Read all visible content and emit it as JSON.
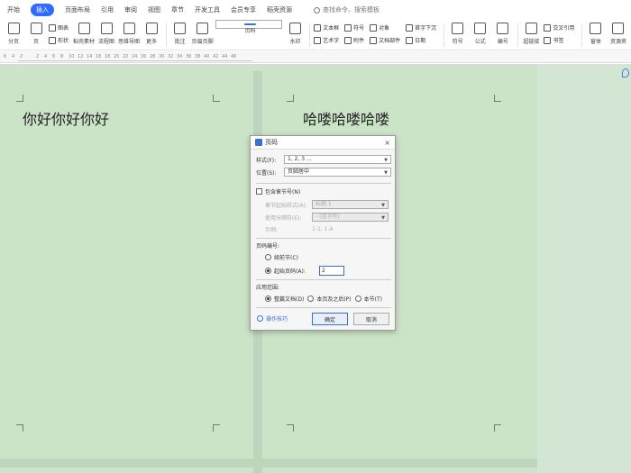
{
  "menu": {
    "items": [
      "开始",
      "插入",
      "页面布局",
      "引用",
      "审阅",
      "视图",
      "章节",
      "开发工具",
      "会员专享",
      "稻壳资源"
    ],
    "active_index": 1,
    "search_text": "查找命令、搜索模板"
  },
  "ribbon": {
    "items_left": [
      "分页",
      "页",
      "图表",
      "形状",
      "稻壳素材",
      "流程图",
      "思维导图",
      "更多",
      "批注",
      "页眉页脚",
      "页码",
      "水印"
    ],
    "groups_mid": [
      {
        "row1": "文本框",
        "row2": "艺术字"
      },
      {
        "row1": "符号",
        "row2": "附件"
      },
      {
        "row1": "对象",
        "row2": "文档部件"
      },
      {
        "row1": "首字下沉",
        "row2": "日期"
      }
    ],
    "items_right": [
      "符号",
      "公式",
      "编号",
      "超链接",
      "交叉引用",
      "书签",
      "窗体",
      "资源夹"
    ],
    "selected_index": 10
  },
  "ruler": {
    "ticks": [
      "6",
      "4",
      "2",
      "",
      "2",
      "4",
      "6",
      "8",
      "10",
      "12",
      "14",
      "16",
      "18",
      "20",
      "22",
      "24",
      "26",
      "28",
      "30",
      "32",
      "34",
      "36",
      "38",
      "40",
      "42",
      "44",
      "46"
    ]
  },
  "document": {
    "page1_text": "你好你好你好",
    "page2_text": "哈喽哈喽哈喽"
  },
  "dialog": {
    "title": "页码",
    "style_label": "样式(F):",
    "style_value": "1, 2, 3 ...",
    "position_label": "位置(S):",
    "position_value": "页脚居中",
    "include_chapter_label": "包含章节号(N)",
    "include_chapter_checked": false,
    "chapter_style_label": "章节起始样式(A):",
    "chapter_style_value": "标题 1",
    "separator_label": "使用分隔符(E):",
    "separator_value": "- (连字符)",
    "example_label": "示例:",
    "example_value": "1-1, 1-A",
    "numbering_label": "页码编号:",
    "continue_label": "续前节(C)",
    "continue_checked": false,
    "start_label": "起始页码(A):",
    "start_checked": true,
    "start_value": "2",
    "apply_label": "应用范围:",
    "apply_whole": "整篇文档(D)",
    "apply_whole_checked": true,
    "apply_after": "本页及之后(P)",
    "apply_after_checked": false,
    "apply_section": "本节(T)",
    "apply_section_checked": false,
    "tips_link": "操作技巧",
    "ok_label": "确定",
    "cancel_label": "取消"
  }
}
